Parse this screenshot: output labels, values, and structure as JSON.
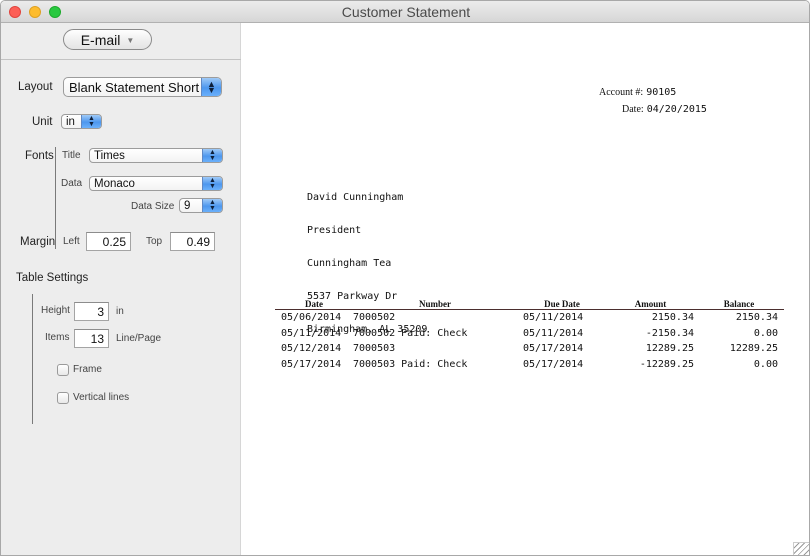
{
  "window": {
    "title": "Customer Statement"
  },
  "sidebar": {
    "email_button": "E-mail",
    "layout": {
      "label": "Layout",
      "value": "Blank Statement Short"
    },
    "unit": {
      "label": "Unit",
      "value": "in"
    },
    "fonts": {
      "label": "Fonts",
      "title_label": "Title",
      "title_value": "Times",
      "data_label": "Data",
      "data_value": "Monaco",
      "data_size_label": "Data Size",
      "data_size_value": "9"
    },
    "margin": {
      "label": "Margin",
      "left_label": "Left",
      "left_value": "0.25",
      "top_label": "Top",
      "top_value": "0.49"
    },
    "table_settings": {
      "label": "Table Settings",
      "height_label": "Height",
      "height_value": "3",
      "height_unit": "in",
      "items_label": "Items",
      "items_value": "13",
      "items_unit": "Line/Page",
      "frame_label": "Frame",
      "frame_checked": false,
      "vertical_lines_label": "Vertical lines",
      "vertical_lines_checked": false
    }
  },
  "preview": {
    "account_label": "Account #:",
    "account_value": "90105",
    "date_label": "Date:",
    "date_value": "04/20/2015",
    "address": [
      "David Cunningham",
      "President",
      "Cunningham Tea",
      "5537 Parkway Dr",
      "Birmingham, AL 35209"
    ],
    "table": {
      "headers": [
        "Date",
        "Number",
        "Due Date",
        "Amount",
        "Balance"
      ],
      "rows": [
        [
          "05/06/2014",
          "7000502",
          "05/11/2014",
          "2150.34",
          "2150.34"
        ],
        [
          "05/11/2014",
          "7000502 Paid: Check",
          "05/11/2014",
          "-2150.34",
          "0.00"
        ],
        [
          "05/12/2014",
          "7000503",
          "05/17/2014",
          "12289.25",
          "12289.25"
        ],
        [
          "05/17/2014",
          "7000503 Paid: Check",
          "05/17/2014",
          "-12289.25",
          "0.00"
        ]
      ]
    }
  }
}
